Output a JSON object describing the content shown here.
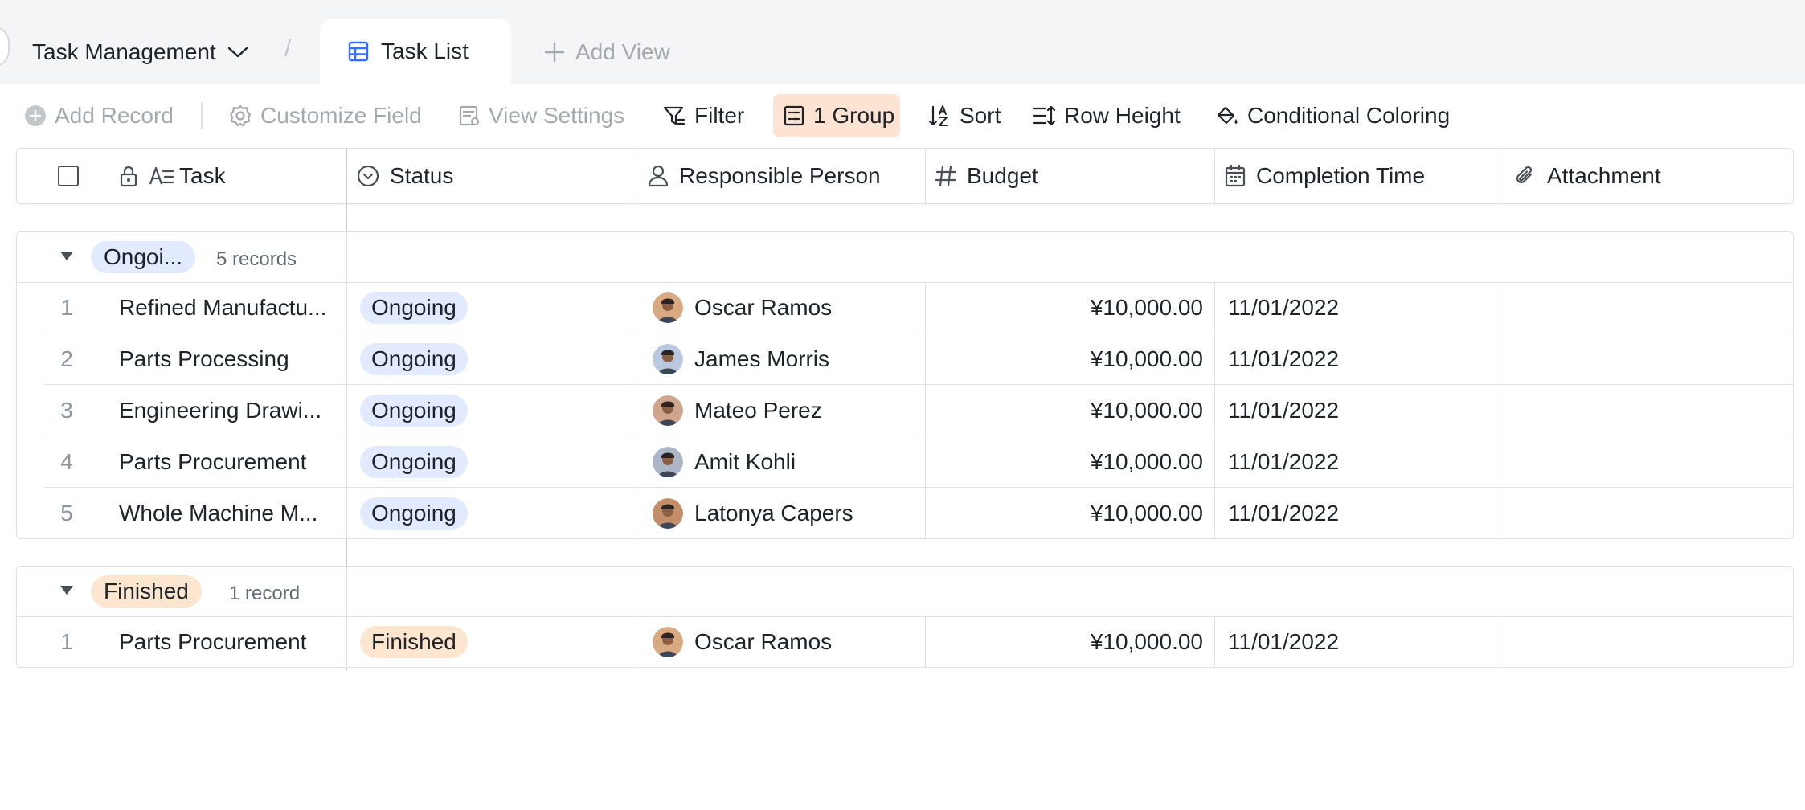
{
  "breadcrumb": {
    "title": "Task Management"
  },
  "tabs": [
    {
      "label": "Task List",
      "active": true
    }
  ],
  "add_view_label": "Add View",
  "toolbar": {
    "add_record": "Add Record",
    "customize_field": "Customize Field",
    "view_settings": "View Settings",
    "filter": "Filter",
    "group": "1 Group",
    "sort": "Sort",
    "row_height": "Row Height",
    "conditional_coloring": "Conditional Coloring"
  },
  "columns": {
    "task": "Task",
    "status": "Status",
    "person": "Responsible Person",
    "budget": "Budget",
    "completion": "Completion Time",
    "attachment": "Attachment"
  },
  "groups": [
    {
      "label": "Ongoi...",
      "count": "5 records",
      "color": "#e1eaff",
      "rows": [
        {
          "index": "1",
          "task": "Refined Manufactu...",
          "status": "Ongoing",
          "person": "Oscar Ramos",
          "budget": "¥10,000.00",
          "completion": "11/01/2022"
        },
        {
          "index": "2",
          "task": "Parts Processing",
          "status": "Ongoing",
          "person": "James Morris",
          "budget": "¥10,000.00",
          "completion": "11/01/2022"
        },
        {
          "index": "3",
          "task": "Engineering Drawi...",
          "status": "Ongoing",
          "person": "Mateo Perez",
          "budget": "¥10,000.00",
          "completion": "11/01/2022"
        },
        {
          "index": "4",
          "task": "Parts Procurement",
          "status": "Ongoing",
          "person": "Amit Kohli",
          "budget": "¥10,000.00",
          "completion": "11/01/2022"
        },
        {
          "index": "5",
          "task": "Whole Machine M...",
          "status": "Ongoing",
          "person": "Latonya Capers",
          "budget": "¥10,000.00",
          "completion": "11/01/2022"
        }
      ]
    },
    {
      "label": "Finished",
      "count": "1 record",
      "color": "#fde6cf",
      "rows": [
        {
          "index": "1",
          "task": "Parts Procurement",
          "status": "Finished",
          "person": "Oscar Ramos",
          "budget": "¥10,000.00",
          "completion": "11/01/2022"
        }
      ]
    }
  ],
  "colors": {
    "accent": "#3370ff",
    "group_button_bg": "#fde3d2",
    "ongoing_tag": "#e1eaff",
    "finished_tag": "#fde6cf"
  }
}
